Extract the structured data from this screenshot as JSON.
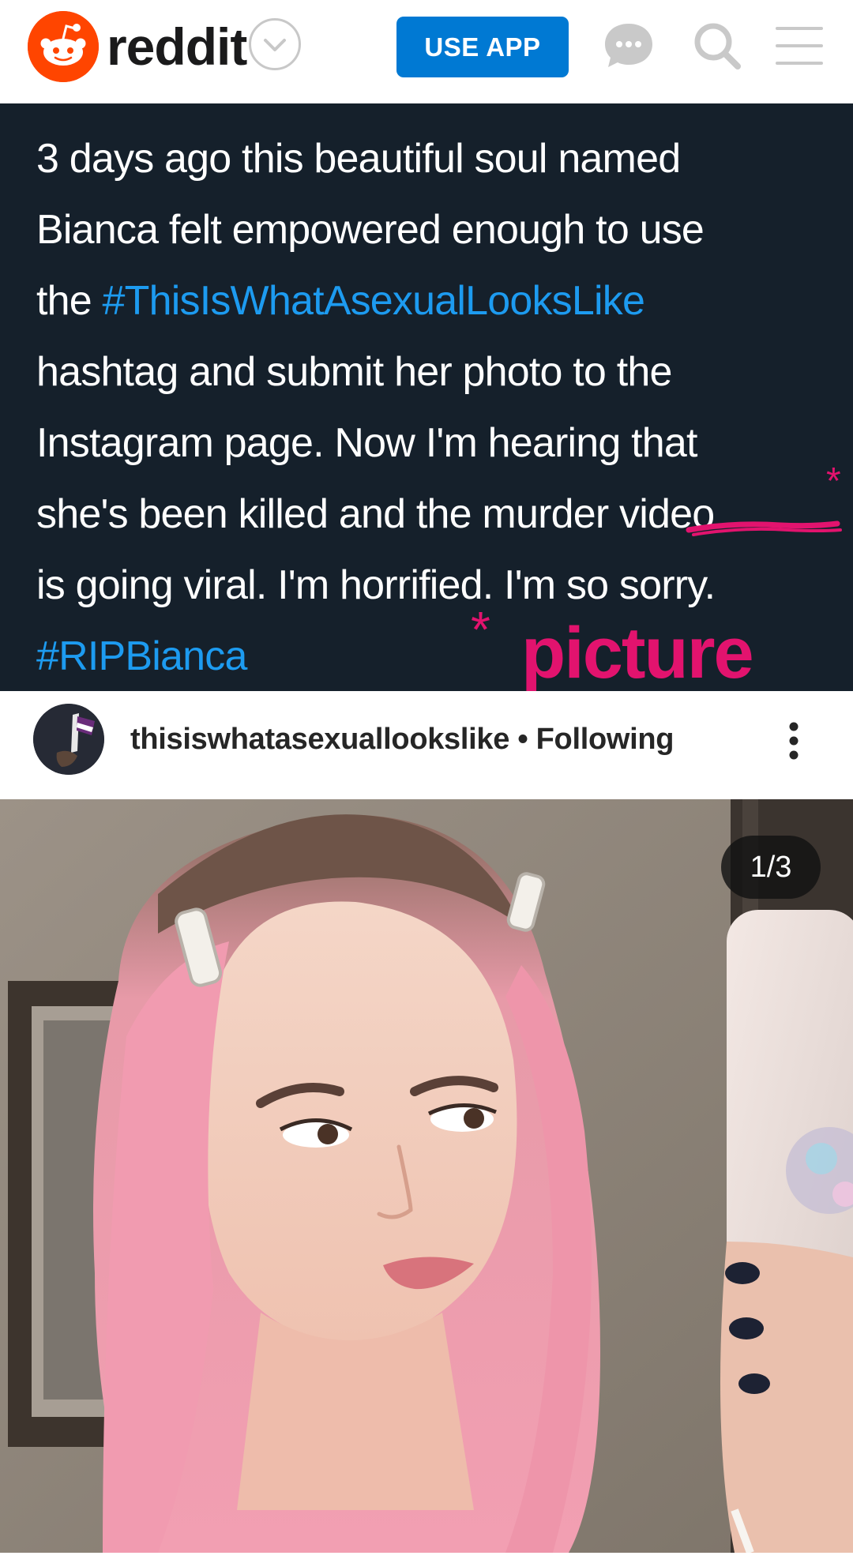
{
  "header": {
    "wordmark": "reddit",
    "use_app_label": "USE APP",
    "icons": [
      "reddit-logo-icon",
      "chevron-down-icon",
      "chat-icon",
      "search-icon",
      "menu-icon"
    ],
    "colors": {
      "brand": "#ff4500",
      "button": "#0079d3"
    }
  },
  "tweet": {
    "lines": [
      "3 days ago this beautiful soul named",
      "Bianca felt empowered enough to use",
      "the ",
      "hashtag and submit her photo to the",
      "Instagram page. Now I'm hearing that",
      "she's been killed and the murder ",
      "is going viral. I'm horrified. I'm so sorry."
    ],
    "hashtag_1": "#ThisIsWhatAsexualLooksLike",
    "struck_word": "video",
    "hashtag_2": "#RIPBianca",
    "annotation_asterisk": "*",
    "annotation_word": "picture",
    "colors": {
      "background": "#15202b",
      "hashtag": "#1d9bf0",
      "annotation": "#e2136e"
    }
  },
  "instagram": {
    "username": "thisiswhatasexuallookslike",
    "separator": "•",
    "follow_status": "Following",
    "image_counter": "1/3",
    "icons": [
      "avatar",
      "more-vertical-icon"
    ]
  }
}
